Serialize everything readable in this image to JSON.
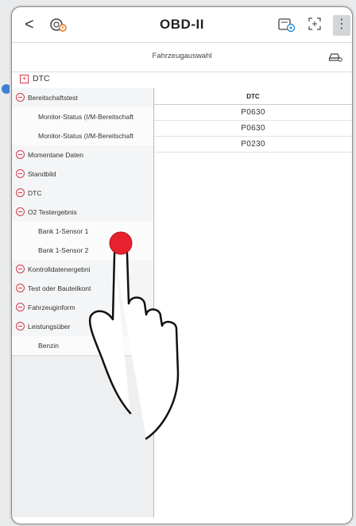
{
  "header": {
    "back_glyph": "<",
    "title": "OBD-II",
    "menu_glyph": "⋮",
    "icons": [
      "back-icon",
      "app-logo-icon",
      "data-logger-icon",
      "expand-icon",
      "more-menu-icon"
    ]
  },
  "subheader": {
    "title": "Fahrzeugauswahl",
    "icon": "car-settings-icon"
  },
  "section": {
    "label": "DTC",
    "icon": "dtc-exit-icon"
  },
  "tree": {
    "items": [
      {
        "label": "Bereitschaftstest",
        "level": 0
      },
      {
        "label": "Monitor-Status (I/M-Bereitschaft",
        "level": 1
      },
      {
        "label": "Monitor-Status (I/M-Bereitschaft",
        "level": 1
      },
      {
        "label": "Momentane Daten",
        "level": 0
      },
      {
        "label": "Standbild",
        "level": 0
      },
      {
        "label": "DTC",
        "level": 0
      },
      {
        "label": "O2 Testergebnis",
        "level": 0
      },
      {
        "label": "Bank 1-Sensor 1",
        "level": 1
      },
      {
        "label": "Bank 1-Sensor 2",
        "level": 1
      },
      {
        "label": "Kontrolldatenergebni",
        "level": 0
      },
      {
        "label": "Test oder Bauteilkont",
        "level": 0
      },
      {
        "label": "Fahrzeuginform",
        "level": 0
      },
      {
        "label": "Leistungsüber",
        "level": 0
      },
      {
        "label": "Benzin",
        "level": 1
      }
    ]
  },
  "table": {
    "header": "DTC",
    "codes": [
      "P0630",
      "P0630",
      "P0230"
    ]
  },
  "overlay": {
    "gesture": "tap",
    "target": "Bank 1-Sensor 1",
    "accent": "#e8212f"
  }
}
